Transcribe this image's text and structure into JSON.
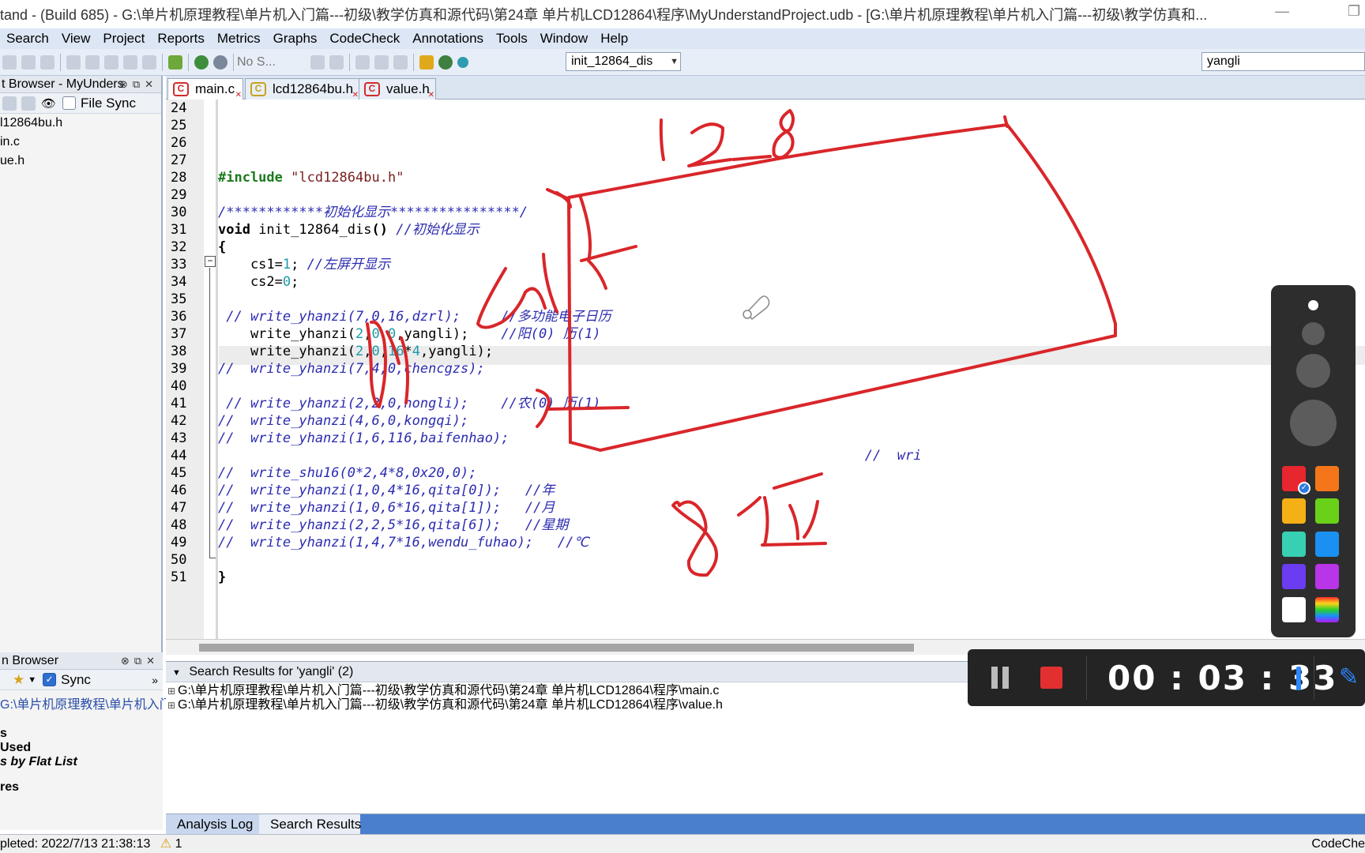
{
  "window": {
    "title": "tand - (Build 685)  - G:\\单片机原理教程\\单片机入门篇---初级\\教学仿真和源代码\\第24章  单片机LCD12864\\程序\\MyUnderstandProject.udb - [G:\\单片机原理教程\\单片机入门篇---初级\\教学仿真和..."
  },
  "menu": [
    "Search",
    "View",
    "Project",
    "Reports",
    "Metrics",
    "Graphs",
    "CodeCheck",
    "Annotations",
    "Tools",
    "Window",
    "Help"
  ],
  "toolbar": {
    "nosearch_label": "No S...",
    "function_combo": "init_12864_dis",
    "search_value": "yangli"
  },
  "project_browser": {
    "title": "t Browser - MyUnders",
    "file_sync": "File Sync",
    "files": [
      "l12864bu.h",
      "in.c",
      "ue.h"
    ]
  },
  "second_browser": {
    "title": "n Browser",
    "sync": "Sync",
    "path": "G:\\单片机原理教程\\单片机入门",
    "items": [
      "s",
      "Used",
      "s by Flat List",
      "res"
    ]
  },
  "tabs": [
    "main.c",
    "lcd12864bu.h",
    "value.h"
  ],
  "editor": {
    "lines": [
      {
        "n": "24",
        "html": ""
      },
      {
        "n": "25",
        "html": ""
      },
      {
        "n": "26",
        "html": ""
      },
      {
        "n": "27",
        "html": ""
      },
      {
        "n": "28",
        "html": "<span class=\"pp\">#include</span> <span class=\"str\">\"lcd12864bu.h\"</span>"
      },
      {
        "n": "29",
        "html": ""
      },
      {
        "n": "30",
        "html": "<span class=\"cm\">/************初始化显示****************/</span>"
      },
      {
        "n": "31",
        "html": "<span class=\"kw\">void</span> init_12864_dis<span class=\"kw\">()</span> <span class=\"cm\">//初始化显示</span>"
      },
      {
        "n": "32",
        "html": "<span class=\"kw\">{</span>"
      },
      {
        "n": "33",
        "html": "    cs1=<span class=\"num\">1</span>; <span class=\"cm\">//左屏开显示</span>"
      },
      {
        "n": "34",
        "html": "    cs2=<span class=\"num\">0</span>;"
      },
      {
        "n": "35",
        "html": ""
      },
      {
        "n": "36",
        "html": " <span class=\"cm\">// write_yhanzi(7,0,16,dzrl);     //多功能电子日历</span>"
      },
      {
        "n": "37",
        "html": "    write_yhanzi(<span class=\"num\">2</span>,<span class=\"num\">0</span>,<span class=\"num\">0</span>,yangli);    <span class=\"cm\">//阳(0) 历(1)</span>"
      },
      {
        "n": "38",
        "html": "    write_yhanzi(<span class=\"num\">2</span>,<span class=\"num\">0</span>,<span class=\"num\">16</span>*<span class=\"num\">4</span>,yangli);"
      },
      {
        "n": "39",
        "html": "<span class=\"cm\">//  write_yhanzi(7,4,0,chencgzs);</span>"
      },
      {
        "n": "40",
        "html": ""
      },
      {
        "n": "41",
        "html": " <span class=\"cm\">// write_yhanzi(2,2,0,nongli);    //农(0) 历(1)</span>"
      },
      {
        "n": "42",
        "html": "<span class=\"cm\">//  write_yhanzi(4,6,0,kongqi);</span>"
      },
      {
        "n": "43",
        "html": "<span class=\"cm\">//  write_yhanzi(1,6,116,baifenhao);</span>"
      },
      {
        "n": "44",
        "html": "<span class=\"cm\">                                                                                //  wri</span>"
      },
      {
        "n": "45",
        "html": "<span class=\"cm\">//  write_shu16(0*2,4*8,0x20,0);</span>"
      },
      {
        "n": "46",
        "html": "<span class=\"cm\">//  write_yhanzi(1,0,4*16,qita[0]);   //年</span>"
      },
      {
        "n": "47",
        "html": "<span class=\"cm\">//  write_yhanzi(1,0,6*16,qita[1]);   //月</span>"
      },
      {
        "n": "48",
        "html": "<span class=\"cm\">//  write_yhanzi(2,2,5*16,qita[6]);   //星期</span>"
      },
      {
        "n": "49",
        "html": "<span class=\"cm\">//  write_yhanzi(1,4,7*16,wendu_fuhao);   //℃</span>"
      },
      {
        "n": "50",
        "html": ""
      },
      {
        "n": "51",
        "html": "<span class=\"kw\">}</span>"
      }
    ]
  },
  "search_results": {
    "title": "Search Results for 'yangli' (2)",
    "rows": [
      "G:\\单片机原理教程\\单片机入门篇---初级\\教学仿真和源代码\\第24章  单片机LCD12864\\程序\\main.c",
      "G:\\单片机原理教程\\单片机入门篇---初级\\教学仿真和源代码\\第24章  单片机LCD12864\\程序\\value.h"
    ]
  },
  "bottom_tabs": [
    "Analysis Log",
    "Search Results"
  ],
  "status": {
    "left": "pleted: 2022/7/13 21:38:13",
    "warn_count": "1",
    "right": "CodeChe"
  },
  "recorder": {
    "time": "00 : 03 : 33"
  },
  "colors": {
    "ink": "#d9262a",
    "menubar": "#dce6f4",
    "accent": "#4a7fce",
    "swatches": [
      "#e8262d",
      "#f5761a",
      "#f5b015",
      "#6ad119",
      "#38d0b2",
      "#1a90f2",
      "#6b3cf0",
      "#b935e8",
      "#ffffff",
      "rainbow"
    ]
  }
}
